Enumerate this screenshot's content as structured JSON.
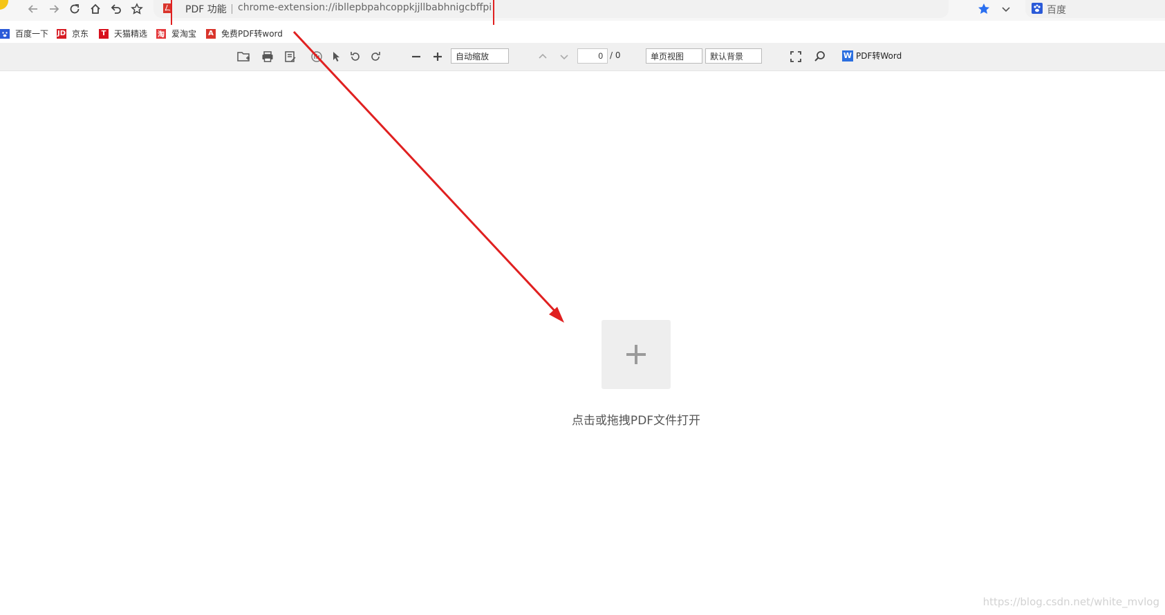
{
  "browser": {
    "omnibox": {
      "scheme_label": "PDF 功能",
      "url": "chrome-extension://ibllepbpahcoppkjjllbabhnigcbffpi"
    },
    "search": {
      "engine_label": "百度"
    },
    "accent_color": "#2a5ad8"
  },
  "bookmarks": {
    "items": [
      {
        "label": "百度一下",
        "icon": "baidu-paw-icon"
      },
      {
        "label": "京东",
        "icon": "jd-icon"
      },
      {
        "label": "天猫精选",
        "icon": "tmall-icon"
      },
      {
        "label": "爱淘宝",
        "icon": "taobao-icon"
      },
      {
        "label": "免费PDF转word",
        "icon": "pdf-icon"
      }
    ]
  },
  "pdf_toolbar": {
    "zoom_select": "自动缩放",
    "page_current": "0",
    "page_total": "/ 0",
    "view_mode": "单页视图",
    "background": "默认背景",
    "convert_label": "PDF转Word"
  },
  "main": {
    "open_hint": "点击或拖拽PDF文件打开"
  },
  "annotation": {
    "color": "#e02020"
  },
  "watermark": "https://blog.csdn.net/white_mvlog"
}
